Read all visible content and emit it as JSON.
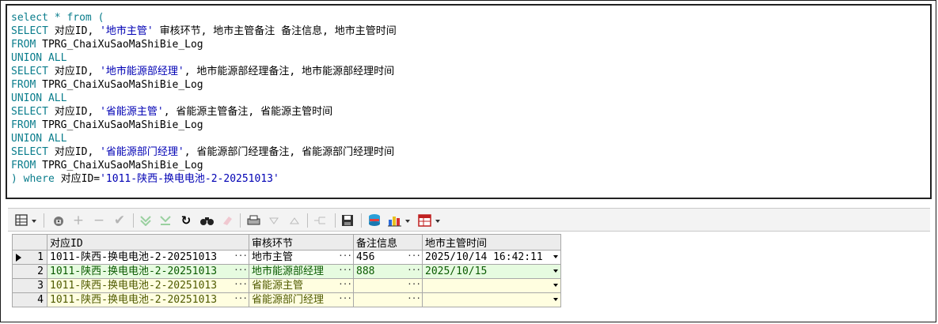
{
  "sql": {
    "lines": [
      [
        {
          "t": "kw",
          "v": "select * from ("
        }
      ],
      [
        {
          "t": "kw",
          "v": "SELECT "
        },
        {
          "t": "txt",
          "v": "对应ID, "
        },
        {
          "t": "str",
          "v": "'地市主管'"
        },
        {
          "t": "txt",
          "v": " 审核环节, 地市主管备注 备注信息, 地市主管时间"
        }
      ],
      [
        {
          "t": "kw",
          "v": "FROM "
        },
        {
          "t": "txt",
          "v": "TPRG_ChaiXuSaoMaShiBie_Log"
        }
      ],
      [
        {
          "t": "kw",
          "v": "UNION ALL"
        }
      ],
      [
        {
          "t": "kw",
          "v": "SELECT "
        },
        {
          "t": "txt",
          "v": "对应ID, "
        },
        {
          "t": "str",
          "v": "'地市能源部经理'"
        },
        {
          "t": "txt",
          "v": ", 地市能源部经理备注, 地市能源部经理时间"
        }
      ],
      [
        {
          "t": "kw",
          "v": "FROM "
        },
        {
          "t": "txt",
          "v": "TPRG_ChaiXuSaoMaShiBie_Log"
        }
      ],
      [
        {
          "t": "kw",
          "v": "UNION ALL"
        }
      ],
      [
        {
          "t": "kw",
          "v": "SELECT "
        },
        {
          "t": "txt",
          "v": "对应ID, "
        },
        {
          "t": "str",
          "v": "'省能源主管'"
        },
        {
          "t": "txt",
          "v": ", 省能源主管备注, 省能源主管时间"
        }
      ],
      [
        {
          "t": "kw",
          "v": "FROM "
        },
        {
          "t": "txt",
          "v": "TPRG_ChaiXuSaoMaShiBie_Log"
        }
      ],
      [
        {
          "t": "kw",
          "v": "UNION ALL"
        }
      ],
      [
        {
          "t": "kw",
          "v": "SELECT "
        },
        {
          "t": "txt",
          "v": "对应ID, "
        },
        {
          "t": "str",
          "v": "'省能源部门经理'"
        },
        {
          "t": "txt",
          "v": ", 省能源部门经理备注, 省能源部门经理时间"
        }
      ],
      [
        {
          "t": "kw",
          "v": "FROM "
        },
        {
          "t": "txt",
          "v": "TPRG_ChaiXuSaoMaShiBie_Log"
        }
      ],
      [
        {
          "t": "kw",
          "v": ") where "
        },
        {
          "t": "txt",
          "v": "对应ID="
        },
        {
          "t": "str",
          "v": "'1011-陕西-换电电池-2-20251013'"
        }
      ]
    ]
  },
  "toolbar": {
    "icons": [
      "grid-view-icon",
      "lock-icon",
      "add-record-icon",
      "delete-record-icon",
      "post-icon",
      "filter-icon",
      "clear-filter-icon",
      "refresh-icon",
      "find-icon",
      "erase-icon",
      "print-icon",
      "sort-desc-icon",
      "sort-asc-icon",
      "link-icon",
      "save-icon",
      "export-icon",
      "chart-icon",
      "table-icon"
    ]
  },
  "grid": {
    "columns": [
      "对应ID",
      "审核环节",
      "备注信息",
      "地市主管时间"
    ],
    "rows": [
      {
        "num": "1",
        "id": "1011-陕西-换电电池-2-20251013",
        "step": "地市主管",
        "note": "456",
        "time": "2025/10/14 16:42:11"
      },
      {
        "num": "2",
        "id": "1011-陕西-换电电池-2-20251013",
        "step": "地市能源部经理",
        "note": "888",
        "time": "2025/10/15"
      },
      {
        "num": "3",
        "id": "1011-陕西-换电电池-2-20251013",
        "step": "省能源主管",
        "note": "",
        "time": ""
      },
      {
        "num": "4",
        "id": "1011-陕西-换电电池-2-20251013",
        "step": "省能源部门经理",
        "note": "",
        "time": ""
      }
    ],
    "current_row": 1
  },
  "colors": {
    "keyword": "#0a7d8c",
    "string": "#0000b4"
  }
}
